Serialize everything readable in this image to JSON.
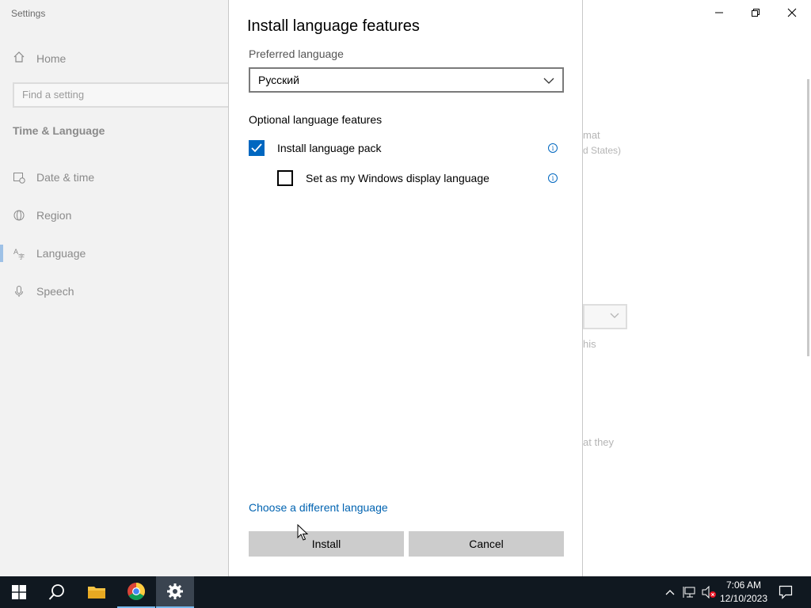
{
  "settings": {
    "app_title": "Settings",
    "home_label": "Home",
    "search_placeholder": "Find a setting",
    "section_title": "Time & Language",
    "nav": [
      {
        "label": "Date & time",
        "icon": "calendar-clock-icon"
      },
      {
        "label": "Region",
        "icon": "globe-icon"
      },
      {
        "label": "Language",
        "icon": "language-icon"
      },
      {
        "label": "Speech",
        "icon": "microphone-icon"
      }
    ],
    "active_nav": "Language",
    "background_text": {
      "format_partial": "mat",
      "states_partial": "d States)",
      "this_partial": "his",
      "they_partial": "at they"
    }
  },
  "dialog": {
    "title": "Install language features",
    "preferred_label": "Preferred language",
    "selected_language": "Русский",
    "optional_heading": "Optional language features",
    "features": [
      {
        "label": "Install language pack",
        "checked": true
      },
      {
        "label": "Set as my Windows display language",
        "checked": false
      }
    ],
    "change_link": "Choose a different language",
    "install_button": "Install",
    "cancel_button": "Cancel"
  },
  "taskbar": {
    "time": "7:06 AM",
    "date": "12/10/2023",
    "apps": [
      "start-icon",
      "search-icon",
      "file-explorer-icon",
      "chrome-icon",
      "settings-gear-icon"
    ]
  },
  "colors": {
    "accent": "#0067c0",
    "link": "#0063b1",
    "taskbar": "#101820"
  }
}
